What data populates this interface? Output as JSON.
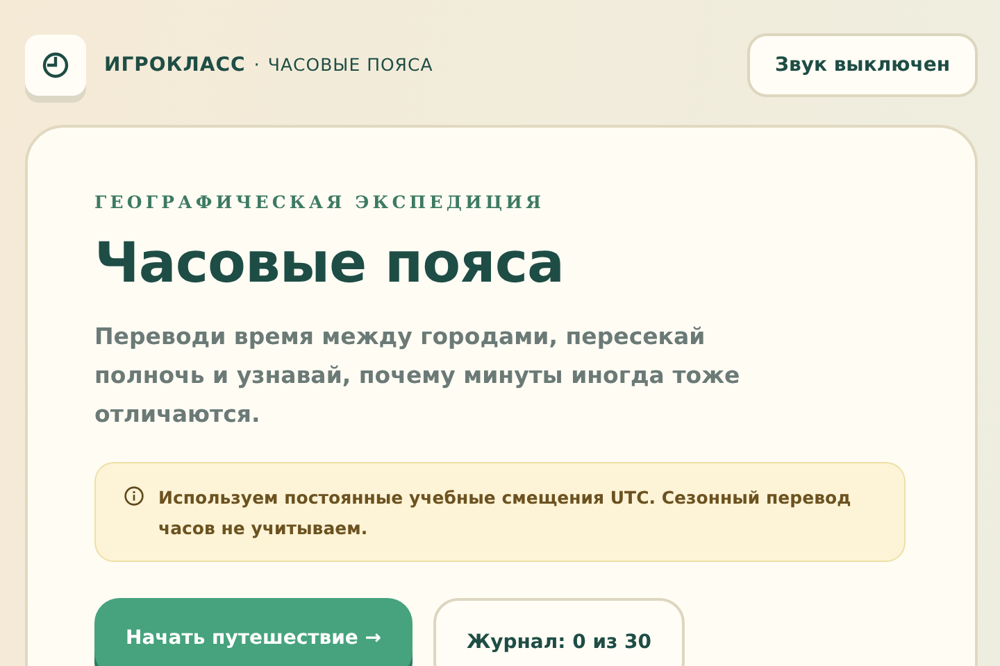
{
  "header": {
    "brand": "ИГРОКЛАСС",
    "separator": "·",
    "section": "ЧАСОВЫЕ ПОЯСА",
    "sound_button": "Звук выключен"
  },
  "card": {
    "eyebrow": "ГЕОГРАФИЧЕСКАЯ ЭКСПЕДИЦИЯ",
    "title": "Часовые пояса",
    "description": "Переводи время между городами, пересекай полночь и узнавай, почему минуты иногда тоже отличаются.",
    "notice": "Используем постоянные учебные смещения UTC. Сезонный перевод часов не учитываем.",
    "start_button": "Начать путешествие →",
    "journal_button": "Журнал: 0 из 30"
  }
}
